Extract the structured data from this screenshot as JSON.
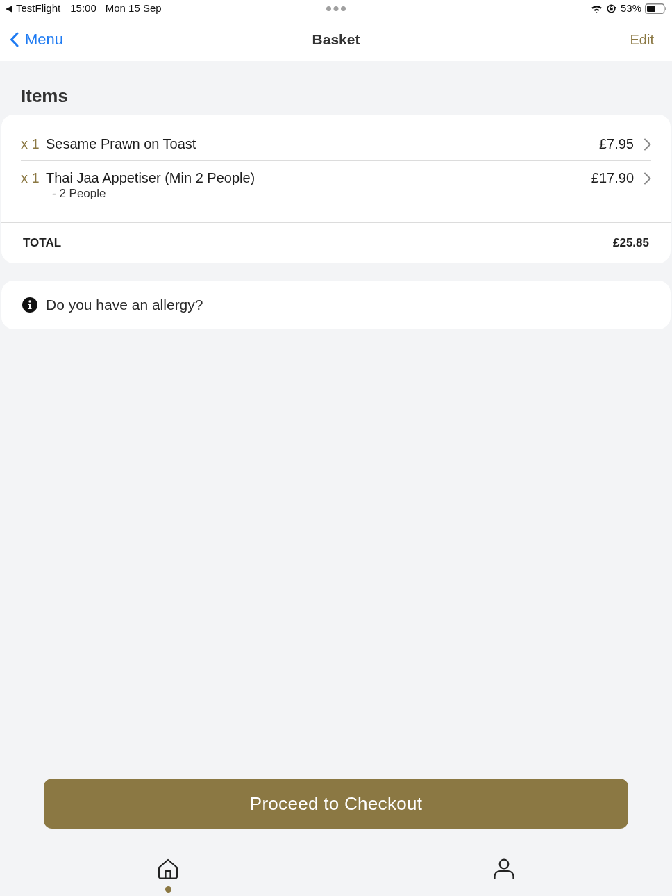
{
  "status_bar": {
    "app": "TestFlight",
    "time": "15:00",
    "date": "Mon 15 Sep",
    "battery": "53%"
  },
  "nav": {
    "back_label": "Menu",
    "title": "Basket",
    "action": "Edit"
  },
  "section_title": "Items",
  "items": [
    {
      "quantity": "x 1",
      "name": "Sesame Prawn on Toast",
      "price": "£7.95"
    },
    {
      "quantity": "x 1",
      "name": "Thai Jaa Appetiser (Min 2 People)",
      "options": [
        "- 2 People"
      ],
      "price": "£17.90"
    }
  ],
  "total": {
    "label": "TOTAL",
    "amount": "£25.85"
  },
  "allergy_prompt": "Do you have an allergy?",
  "checkout_button": "Proceed to Checkout",
  "tab_bar": [
    {
      "kind": "home",
      "selected": true
    },
    {
      "kind": "profile",
      "selected": false
    }
  ]
}
